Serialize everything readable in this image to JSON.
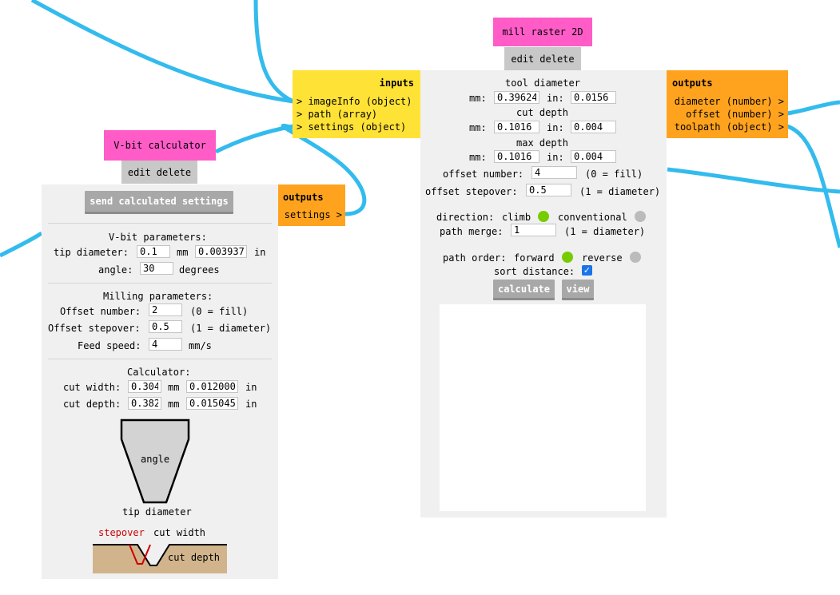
{
  "colors": {
    "wire": "#33bbee",
    "title_bg": "#ff5cc8",
    "inputs_bg": "#ffe236",
    "outputs_bg": "#ffa31e",
    "panel_bg": "#f0f0f0",
    "radio_on": "#77cc00",
    "radio_off": "#bbbbbb",
    "stepover_red": "#cc0000",
    "material": "#d2b48c"
  },
  "vbit": {
    "title": "V-bit calculator",
    "edit": "edit",
    "delete": "delete",
    "send_button": "send calculated settings",
    "outputs_title": "outputs",
    "outputs": [
      "settings >"
    ],
    "params_heading": "V-bit parameters:",
    "tip_label": "tip diameter:",
    "tip_mm": "0.1",
    "mm": "mm",
    "tip_in": "0.003937007874015748",
    "in": "in",
    "angle_label": "angle:",
    "angle": "30",
    "degrees": "degrees",
    "milling_heading": "Milling parameters:",
    "offset_number_label": "Offset number:",
    "offset_number": "2",
    "offset_number_hint": "(0 = fill)",
    "offset_stepover_label": "Offset stepover:",
    "offset_stepover": "0.5",
    "offset_stepover_hint": "(1 = diameter)",
    "feed_label": "Feed speed:",
    "feed": "4",
    "feed_unit": "mm/s",
    "calc_heading": "Calculator:",
    "cut_width_label": "cut width:",
    "cut_width_mm": "0.304",
    "cut_width_in": "0.0120000",
    "cut_depth_label": "cut depth:",
    "cut_depth_mm": "0.382",
    "cut_depth_in": "0.0150457",
    "diagram_angle": "angle",
    "diagram_tip": "tip diameter",
    "diagram_stepover": "stepover",
    "diagram_cut_width": "cut width",
    "diagram_cut_depth": "cut depth"
  },
  "mill": {
    "title": "mill raster 2D",
    "edit": "edit",
    "delete": "delete",
    "inputs_title": "inputs",
    "inputs": [
      "> imageInfo (object)",
      "> path (array)",
      "> settings (object)"
    ],
    "outputs_title": "outputs",
    "outputs": [
      "diameter (number) >",
      "offset (number) >",
      "toolpath (object) >"
    ],
    "tool_diameter_label": "tool diameter",
    "mm_label": "mm:",
    "in_label": "in:",
    "tool_mm": "0.39624",
    "tool_in": "0.0156",
    "cut_depth_label": "cut depth",
    "cut_mm": "0.1016",
    "cut_in": "0.004",
    "max_depth_label": "max depth",
    "max_mm": "0.1016",
    "max_in": "0.004",
    "offset_number_label": "offset number:",
    "offset_number": "4",
    "offset_number_hint": "(0 = fill)",
    "offset_stepover_label": "offset stepover:",
    "offset_stepover": "0.5",
    "offset_stepover_hint": "(1 = diameter)",
    "direction_label": "direction:",
    "climb": "climb",
    "conventional": "conventional",
    "path_merge_label": "path merge:",
    "path_merge": "1",
    "path_merge_hint": "(1 = diameter)",
    "path_order_label": "path order:",
    "forward": "forward",
    "reverse": "reverse",
    "sort_distance_label": "sort distance:",
    "sort_distance_checked": true,
    "calculate_button": "calculate",
    "view_button": "view"
  }
}
